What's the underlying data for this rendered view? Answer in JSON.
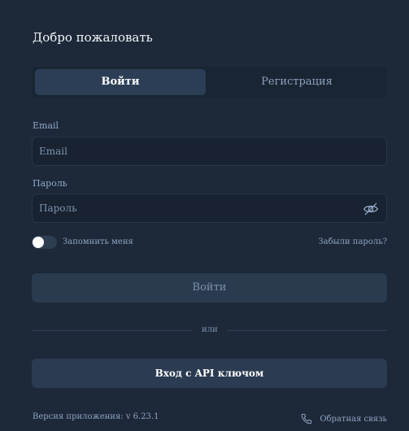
{
  "header": {
    "title": "Добро пожаловать"
  },
  "tabs": {
    "active": "login",
    "login_label": "Войти",
    "register_label": "Регистрация"
  },
  "form": {
    "email_label": "Email",
    "email_placeholder": "Email",
    "email_value": "",
    "password_label": "Пароль",
    "password_placeholder": "Пароль",
    "password_value": "",
    "password_icon": "eye-off-icon",
    "remember_label": "Запомнить меня",
    "remember_checked": false,
    "forgot_label": "Забыли пароль?",
    "submit_label": "Войти",
    "divider_text": "или",
    "api_login_label": "Вход с API ключом"
  },
  "footer": {
    "version_text": "Версия приложения: v 6.23.1",
    "feedback_label": "Обратная связь",
    "feedback_icon": "phone-icon"
  },
  "colors": {
    "background": "#1d2939",
    "accent_tab": "#2c3e56",
    "input_bg": "#182230",
    "muted_text": "#8fa3bf"
  }
}
